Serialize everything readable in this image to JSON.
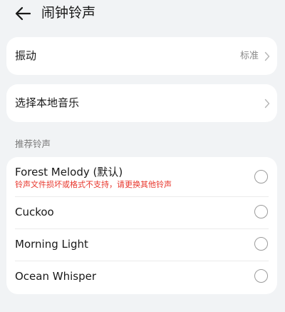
{
  "header": {
    "title": "闹钟铃声",
    "back_icon": "arrow-left-icon"
  },
  "vibrate": {
    "label": "振动",
    "value": "标准"
  },
  "local_music": {
    "label": "选择本地音乐"
  },
  "recommended": {
    "section_label": "推荐铃声",
    "items": [
      {
        "name": "Forest Melody (默认)",
        "error": "铃声文件损坏或格式不支持，请更换其他铃声"
      },
      {
        "name": "Cuckoo"
      },
      {
        "name": "Morning Light"
      },
      {
        "name": "Ocean Whisper"
      }
    ]
  },
  "colors": {
    "background": "#f1f3f5",
    "card": "#ffffff",
    "error": "#e8352b",
    "secondary_text": "#8a8a8a"
  }
}
